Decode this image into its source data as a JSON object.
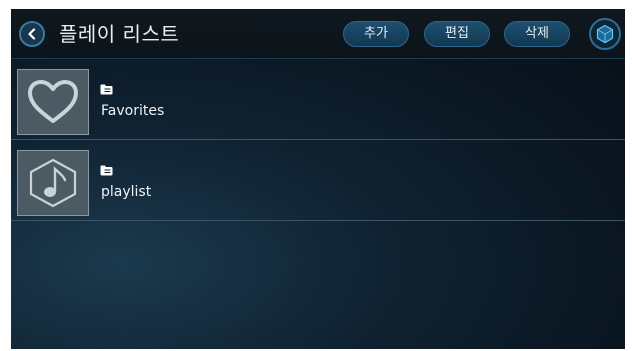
{
  "header": {
    "title": "플레이 리스트",
    "add_label": "추가",
    "edit_label": "편집",
    "delete_label": "삭제"
  },
  "playlists": [
    {
      "label": "Favorites",
      "icon": "heart-icon"
    },
    {
      "label": "playlist",
      "icon": "music-note-icon"
    }
  ],
  "colors": {
    "accent": "#1d4f72",
    "background": "#0f2130",
    "text": "#e8eef2"
  }
}
